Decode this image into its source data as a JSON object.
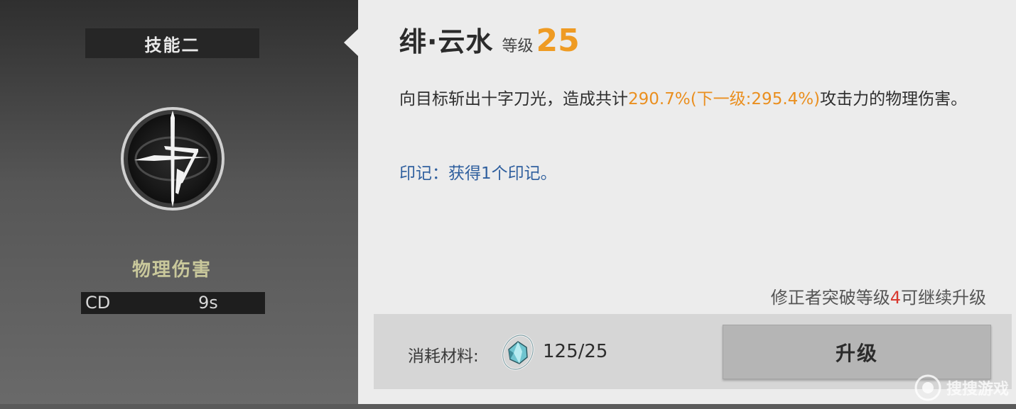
{
  "skill_panel": {
    "tag": "技能二",
    "icon": "cross-slash-icon",
    "damage_type": "物理伤害",
    "cd_label": "CD",
    "cd_value": "9s"
  },
  "detail": {
    "name": "绯·云水",
    "level_label": "等级",
    "level_value": "25",
    "desc_prefix": "向目标斩出十字刀光，造成共计",
    "desc_highlight": "290.7%(下一级:295.4%)",
    "desc_suffix": "攻击力的物理伤害。",
    "mark_text": "印记：获得1个印记。",
    "breakthrough_prefix": "修正者突破等级",
    "breakthrough_level": "4",
    "breakthrough_suffix": "可继续升级",
    "material_label": "消耗材料:",
    "material_icon": "crystal-material-icon",
    "material_count": "125/25",
    "upgrade_label": "升级"
  },
  "watermark": {
    "text": "搜搜游戏"
  },
  "colors": {
    "level": "#ef9b23",
    "highlight": "#ea8f1f",
    "mark": "#2f5f9e",
    "red": "#d8382e",
    "damage_type": "#c9c89b"
  }
}
